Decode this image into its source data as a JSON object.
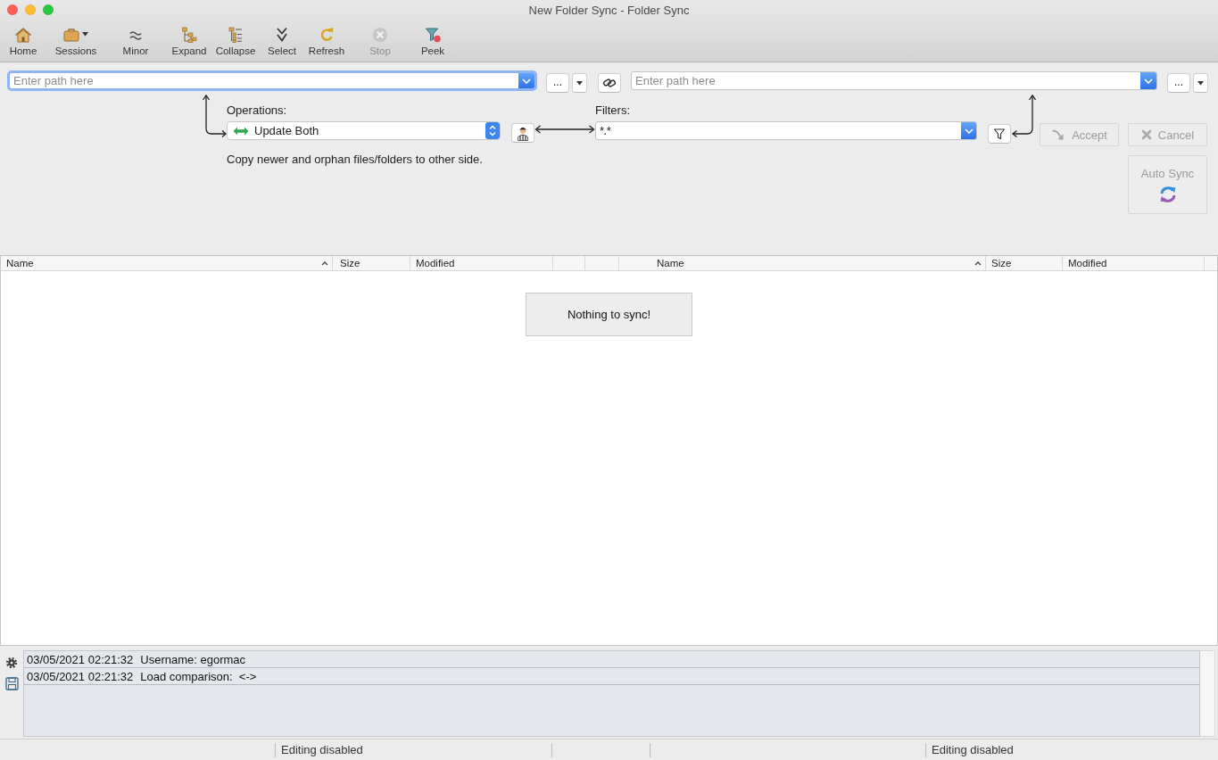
{
  "window": {
    "title": "New Folder Sync - Folder Sync"
  },
  "toolbar": [
    {
      "kind": "home",
      "label": "Home",
      "disabled": false,
      "menu": false
    },
    {
      "kind": "sessions",
      "label": "Sessions",
      "disabled": false,
      "menu": true
    },
    {
      "kind": "minor",
      "label": "Minor",
      "disabled": false,
      "menu": false
    },
    {
      "kind": "expand",
      "label": "Expand",
      "disabled": false,
      "menu": false
    },
    {
      "kind": "collapse",
      "label": "Collapse",
      "disabled": false,
      "menu": false
    },
    {
      "kind": "select",
      "label": "Select",
      "disabled": false,
      "menu": false
    },
    {
      "kind": "refresh",
      "label": "Refresh",
      "disabled": false,
      "menu": false
    },
    {
      "kind": "stop",
      "label": "Stop",
      "disabled": true,
      "menu": false
    },
    {
      "kind": "peek",
      "label": "Peek",
      "disabled": false,
      "menu": false
    }
  ],
  "left_path": {
    "placeholder": "Enter path here",
    "focused": true,
    "browse_label": "..."
  },
  "right_path": {
    "placeholder": "Enter path here",
    "focused": false,
    "browse_label": "..."
  },
  "operations": {
    "label": "Operations:",
    "value": "Update Both",
    "description": "Copy newer and orphan files/folders to other side."
  },
  "filters": {
    "label": "Filters:",
    "value": "*.*"
  },
  "actions": [
    {
      "kind": "accept",
      "label": "Accept",
      "disabled": true
    },
    {
      "kind": "cancel",
      "label": "Cancel",
      "disabled": true
    }
  ],
  "auto_sync": {
    "label": "Auto Sync",
    "disabled": true
  },
  "table": {
    "left_columns": [
      {
        "label": "Name",
        "sorted": true
      },
      {
        "label": "Size",
        "sorted": false
      },
      {
        "label": "Modified",
        "sorted": false
      }
    ],
    "right_columns": [
      {
        "label": "Name",
        "sorted": true
      },
      {
        "label": "Size",
        "sorted": false
      },
      {
        "label": "Modified",
        "sorted": false
      }
    ],
    "empty_message": "Nothing to sync!"
  },
  "log": [
    {
      "time": "03/05/2021 02:21:32",
      "message": "Username: egormac"
    },
    {
      "time": "03/05/2021 02:21:32",
      "message": "Load comparison:  <->"
    }
  ],
  "status_bar": {
    "left": "Editing disabled",
    "right": "Editing disabled"
  }
}
